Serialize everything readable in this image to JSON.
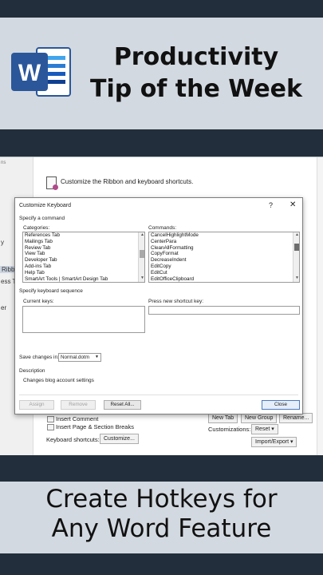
{
  "banner": {
    "line1": "Productivity",
    "line2": "Tip of the Week",
    "logo_letter": "W"
  },
  "background_window": {
    "title_fragment": "ns",
    "customize_heading": "Customize the Ribbon and keyboard shortcuts.",
    "left_items": [
      "y",
      "Ribbo",
      "ess Too",
      "er"
    ],
    "insert_comment": "Insert Comment",
    "insert_page_breaks": "Insert Page & Section Breaks",
    "keyboard_shortcuts_label": "Keyboard shortcuts:",
    "customize_button": "Customize...",
    "new_tab_button": "New Tab",
    "new_group_button": "New Group",
    "rename_button": "Rename...",
    "customizations_label": "Customizations:",
    "reset_button": "Reset ▾",
    "import_export_button": "Import/Export ▾"
  },
  "dialog": {
    "title": "Customize Keyboard",
    "help": "?",
    "close_glyph": "✕",
    "specify_command": "Specify a command",
    "categories_label": "Categories:",
    "categories": [
      "References Tab",
      "Mailings Tab",
      "Review Tab",
      "View Tab",
      "Developer Tab",
      "Add-ins Tab",
      "Help Tab",
      "SmartArt Tools | SmartArt Design Tab"
    ],
    "commands_label": "Commands:",
    "commands": [
      "CancelHighlightMode",
      "CenterPara",
      "CleanAllFormatting",
      "CopyFormat",
      "DecreaseIndent",
      "EditCopy",
      "EditCut",
      "EditOfficeClipboard"
    ],
    "specify_sequence": "Specify keyboard sequence",
    "current_keys_label": "Current keys:",
    "new_shortcut_label": "Press new shortcut key:",
    "save_changes_label": "Save changes in:",
    "save_changes_value": "Normal.dotm",
    "description_label": "Description",
    "description_text": "Changes blog account settings",
    "assign_button": "Assign",
    "remove_button": "Remove",
    "reset_all_button": "Reset All...",
    "close_button": "Close"
  },
  "caption": {
    "line1": "Create Hotkeys for",
    "line2": "Any Word Feature"
  },
  "colors": {
    "page_background": "#222e3b",
    "card_background": "#d3d9e0",
    "word_blue": "#2b579a"
  }
}
